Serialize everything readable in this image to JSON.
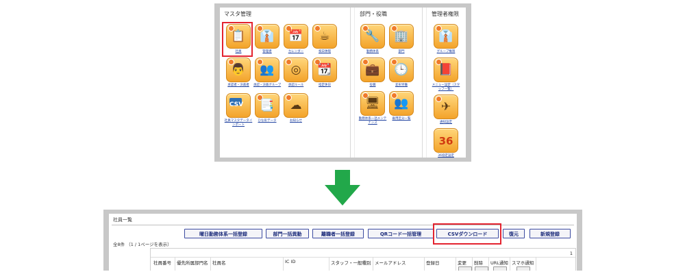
{
  "menu": {
    "sections": [
      {
        "title": "マスタ管理",
        "items": [
          {
            "label": "社員",
            "glyph": "📋",
            "icon": "staff-icon"
          },
          {
            "label": "管理者",
            "glyph": "👔",
            "icon": "admin-icon"
          },
          {
            "label": "カレンダー",
            "glyph": "📅",
            "icon": "calendar-icon"
          },
          {
            "label": "祝日休暇",
            "glyph": "☕",
            "icon": "holiday-icon"
          },
          {
            "label": "承認者・決裁者",
            "glyph": "👨",
            "icon": "approver-icon"
          },
          {
            "label": "承認・決裁グループ",
            "glyph": "👥",
            "icon": "approval-group-icon"
          },
          {
            "label": "承認ルール",
            "glyph": "◎",
            "icon": "approval-rule-icon"
          },
          {
            "label": "指定休日",
            "glyph": "📆",
            "icon": "designated-holiday-icon"
          },
          {
            "label": "社員マスタデータインポート",
            "glyph": "CSV",
            "icon": "csv-import-icon"
          },
          {
            "label": "ひな形データ",
            "glyph": "📑",
            "icon": "template-icon"
          },
          {
            "label": "お知らせ",
            "glyph": "☁",
            "icon": "notice-icon"
          }
        ]
      },
      {
        "title": "部門・役職",
        "items": [
          {
            "label": "勤務体系",
            "glyph": "🔧",
            "icon": "work-system-icon"
          },
          {
            "label": "部門",
            "glyph": "🏢",
            "icon": "department-icon"
          },
          {
            "label": "役職",
            "glyph": "💼",
            "icon": "position-icon"
          },
          {
            "label": "変形労働",
            "glyph": "🕒",
            "icon": "variable-labor-icon"
          },
          {
            "label": "勤務体系一括メンテナンス",
            "glyph": "🖥",
            "icon": "bulk-maintenance-icon"
          },
          {
            "label": "雇用区分一覧",
            "glyph": "👥",
            "icon": "employment-type-icon"
          }
        ]
      },
      {
        "title": "管理者権限",
        "items": [
          {
            "label": "グループ権限",
            "glyph": "👔",
            "icon": "group-permission-icon"
          },
          {
            "label": "メニュー設定（スタッフ一覧）",
            "glyph": "📕",
            "icon": "menu-setting-icon"
          },
          {
            "label": "通知設定",
            "glyph": "✈",
            "icon": "notification-icon"
          },
          {
            "label": "36協定設定",
            "glyph": "36",
            "icon": "agreement-36-icon"
          }
        ]
      }
    ]
  },
  "list": {
    "title": "社員一覧",
    "buttons": [
      "曜日勤務体系一括登録",
      "部門一括異動",
      "離職者一括登録",
      "QRコード一括管理",
      "CSVダウンロード",
      "復元",
      "新規登録"
    ],
    "count_text": "全8件 （1 / 1ページを表示）",
    "page_number": "1",
    "columns": [
      "社員番号",
      "優先所属部門名",
      "社員名",
      "IC ID",
      "スタッフ・一般種別",
      "メールアドレス",
      "登録日",
      "変更",
      "削除",
      "URL通知",
      "スマホ通知"
    ]
  },
  "colors": {
    "highlight": "#e3232f",
    "arrow": "#22a84a",
    "link": "#1c3f9e",
    "button_border": "#3b4aa0"
  }
}
